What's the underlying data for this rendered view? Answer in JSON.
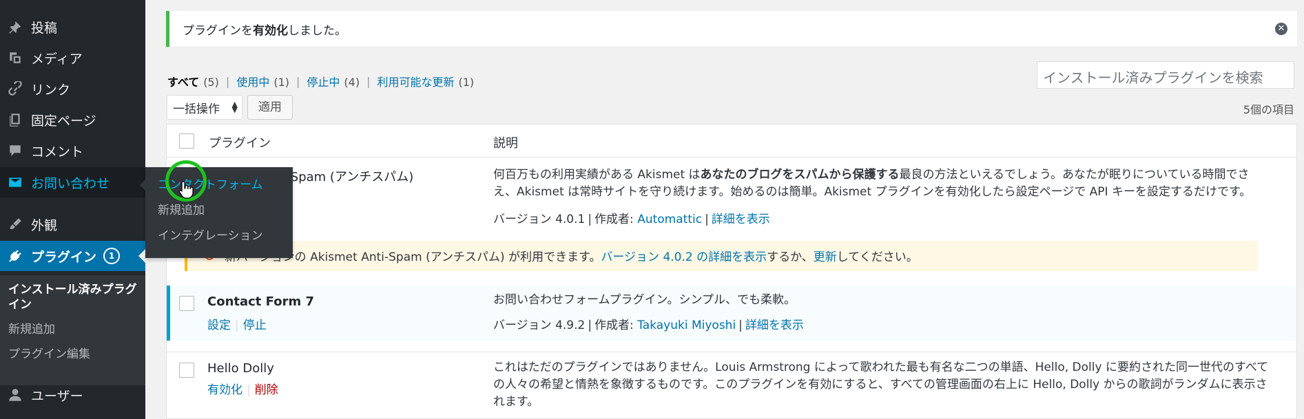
{
  "sidebar": {
    "items": [
      {
        "label": "投稿",
        "icon": "pin-icon"
      },
      {
        "label": "メディア",
        "icon": "media-icon"
      },
      {
        "label": "リンク",
        "icon": "link-icon"
      },
      {
        "label": "固定ページ",
        "icon": "pages-icon"
      },
      {
        "label": "コメント",
        "icon": "comment-icon"
      },
      {
        "label": "お問い合わせ",
        "icon": "mail-icon"
      },
      {
        "label": "外観",
        "icon": "brush-icon"
      },
      {
        "label": "プラグイン",
        "icon": "plugin-icon",
        "badge": "1"
      },
      {
        "label": "ユーザー",
        "icon": "user-icon"
      }
    ],
    "plugins_submenu": [
      "インストール済みプラグイン",
      "新規追加",
      "プラグイン編集"
    ],
    "contact_flyout": [
      "コンタクトフォーム",
      "新規追加",
      "インテグレーション"
    ]
  },
  "notice": {
    "prefix": "プラグインを",
    "bold": "有効化",
    "suffix": "しました。",
    "dismiss_icon": "close-icon"
  },
  "filters": [
    {
      "label": "すべて",
      "count": "(5)",
      "current": true
    },
    {
      "label": "使用中",
      "count": "(1)"
    },
    {
      "label": "停止中",
      "count": "(4)"
    },
    {
      "label": "利用可能な更新",
      "count": "(1)"
    }
  ],
  "search": {
    "placeholder": "インストール済みプラグインを検索"
  },
  "bulk_actions": {
    "selected": "一括操作",
    "apply": "適用"
  },
  "items_count": "5個の項目",
  "table": {
    "headers": {
      "name": "プラグイン",
      "description": "説明"
    },
    "rows": [
      {
        "name": "Akismet Anti-Spam (アンチスパム)",
        "description_parts": [
          "何百万もの利用実績がある Akismet は",
          "あなたのブログをスパムから保護する",
          "最良の方法といえるでしょう。あなたが眠りについている時間でさえ、Akismet は常時サイトを守り続けます。始めるのは簡単。Akismet プラグインを有効化したら設定ページで API キーを設定するだけです。"
        ],
        "version": "バージョン 4.0.1",
        "author_label": "作成者:",
        "author": "Automattic",
        "details": "詳細を表示",
        "update": {
          "text_before": "新バージョンの Akismet Anti-Spam (アンチスパム) が利用できます。",
          "link1": "バージョン 4.0.2 の詳細を表示",
          "text_mid": "するか、",
          "link2": "更新",
          "text_after": "してください。",
          "icon": "update-icon"
        }
      },
      {
        "name": "Contact Form 7",
        "actions": [
          "設定",
          "停止"
        ],
        "description": "お問い合わせフォームプラグイン。シンプル、でも柔軟。",
        "version": "バージョン 4.9.2",
        "author_label": "作成者:",
        "author": "Takayuki Miyoshi",
        "details": "詳細を表示",
        "active": true
      },
      {
        "name": "Hello Dolly",
        "actions": [
          "有効化",
          "削除"
        ],
        "description": "これはただのプラグインではありません。Louis Armstrong によって歌われた最も有名な二つの単語、Hello, Dolly に要約された同一世代のすべての人々の希望と情熱を象徴するものです。このプラグインを有効にすると、すべての管理画面の右上に Hello, Dolly からの歌詞がランダムに表示されます。"
      }
    ]
  },
  "colors": {
    "sidebar_bg": "#23282d",
    "accent": "#0073aa",
    "success": "#46b450",
    "warning": "#ffb900",
    "click_ring": "#1ec21e"
  }
}
